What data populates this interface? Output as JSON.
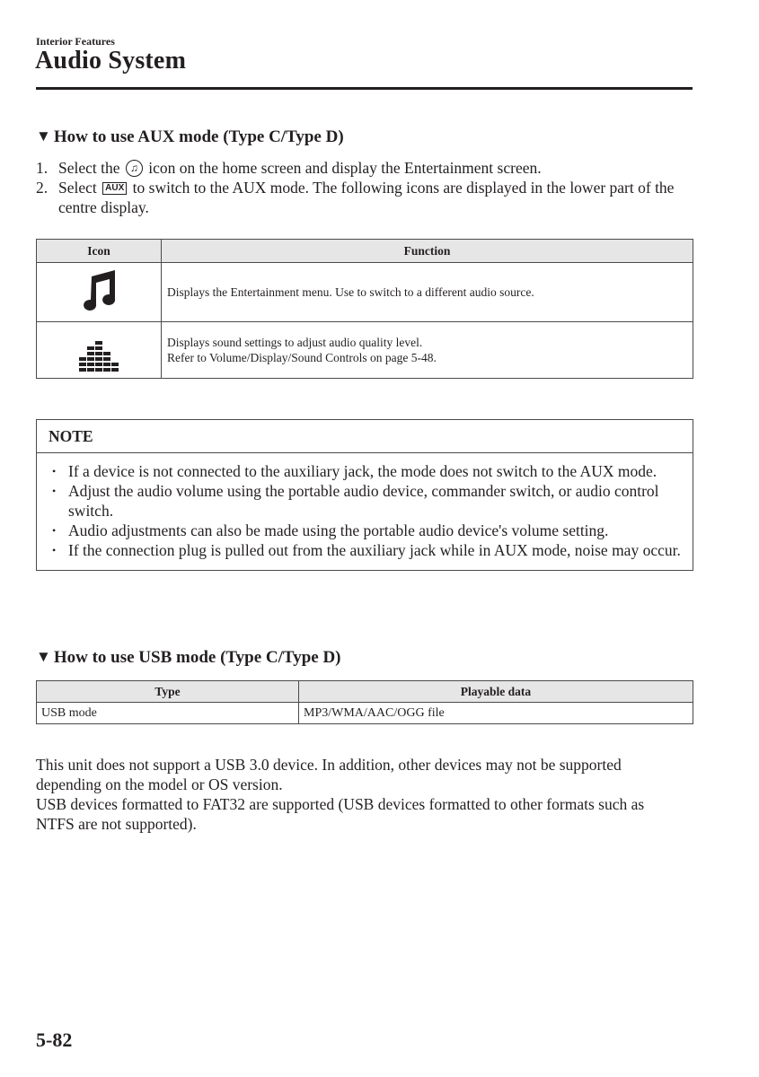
{
  "header": {
    "section": "Interior Features",
    "title": "Audio System"
  },
  "aux": {
    "heading": "How to use AUX mode (Type C/Type D)",
    "steps": [
      {
        "num": "1.",
        "before": "Select the",
        "icon": "music-note-circle-icon",
        "after": "icon on the home screen and display the Entertainment screen."
      },
      {
        "num": "2.",
        "before": "Select",
        "button_label": "AUX",
        "after": "to switch to the AUX mode. The following icons are displayed in the lower part of the centre display."
      }
    ],
    "table": {
      "headers": [
        "Icon",
        "Function"
      ],
      "rows": [
        {
          "icon": "music-note-icon",
          "function_lines": [
            "Displays the Entertainment menu. Use to switch to a different audio source."
          ]
        },
        {
          "icon": "sound-settings-equalizer-icon",
          "function_lines": [
            "Displays sound settings to adjust audio quality level.",
            "Refer to Volume/Display/Sound Controls on page 5-48."
          ]
        }
      ]
    }
  },
  "note": {
    "title": "NOTE",
    "items": [
      "If a device is not connected to the auxiliary jack, the mode does not switch to the AUX mode.",
      "Adjust the audio volume using the portable audio device, commander switch, or audio control switch.",
      "Audio adjustments can also be made using the portable audio device's volume setting.",
      "If the connection plug is pulled out from the auxiliary jack while in AUX mode, noise may occur."
    ]
  },
  "usb": {
    "heading": "How to use USB mode (Type C/Type D)",
    "table": {
      "headers": [
        "Type",
        "Playable data"
      ],
      "rows": [
        [
          "USB mode",
          "MP3/WMA/AAC/OGG file"
        ]
      ]
    },
    "paragraphs": [
      "This unit does not support a USB 3.0 device. In addition, other devices may not be supported depending on the model or OS version.",
      "USB devices formatted to FAT32 are supported (USB devices formatted to other formats such as NTFS are not supported)."
    ]
  },
  "footer": {
    "page_number": "5-82"
  },
  "glyphs": {
    "triangle": "▼",
    "bullet": "•",
    "note": "♫"
  }
}
